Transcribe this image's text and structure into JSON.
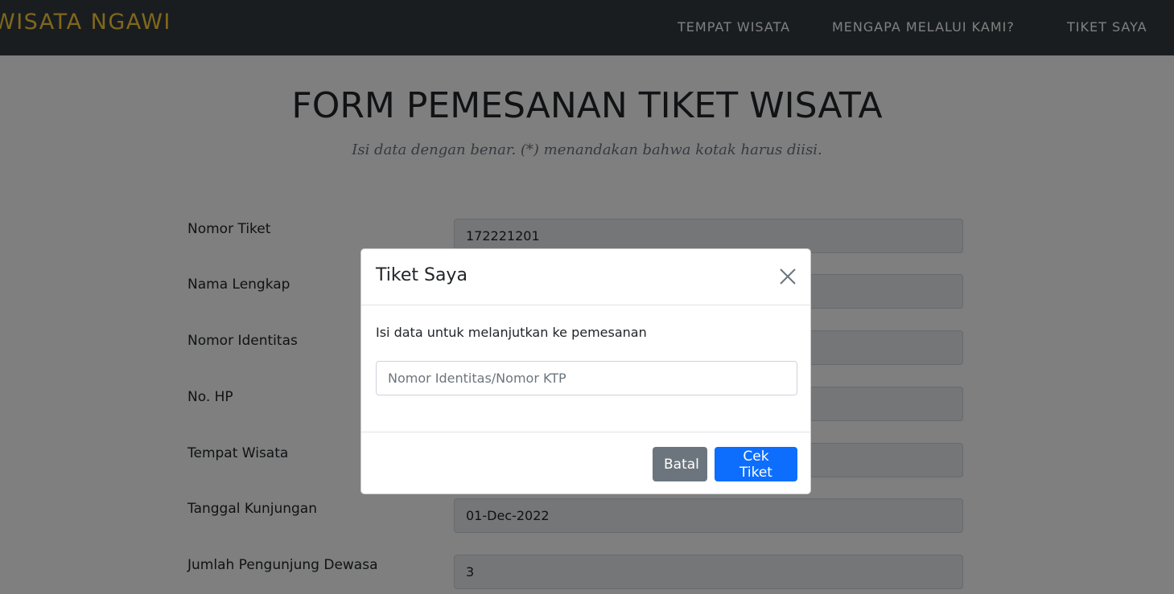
{
  "navbar": {
    "brand": "WISATA NGAWI",
    "links": [
      "TEMPAT WISATA",
      "MENGAPA MELALUI KAMI?",
      "TIKET SAYA"
    ]
  },
  "page": {
    "title": "FORM PEMESANAN TIKET WISATA",
    "subtitle": "Isi data dengan benar. (*) menandakan bahwa kotak harus diisi."
  },
  "form": {
    "fields": [
      {
        "label": "Nomor Tiket",
        "value": "172221201"
      },
      {
        "label": "Nama Lengkap",
        "value": ""
      },
      {
        "label": "Nomor Identitas",
        "value": ""
      },
      {
        "label": "No. HP",
        "value": ""
      },
      {
        "label": "Tempat Wisata",
        "value": ""
      },
      {
        "label": "Tanggal Kunjungan",
        "value": "01-Dec-2022"
      },
      {
        "label": "Jumlah Pengunjung Dewasa",
        "value": "3"
      }
    ]
  },
  "modal": {
    "title": "Tiket Saya",
    "body_text": "Isi data untuk melanjutkan ke pemesanan",
    "input_placeholder": "Nomor Identitas/Nomor KTP",
    "input_value": "",
    "cancel_label": "Batal",
    "submit_label": "Cek Tiket"
  },
  "colors": {
    "navbar_bg": "#343a40",
    "brand": "#fed136",
    "primary": "#0d6efd",
    "secondary": "#6c757d"
  },
  "icons": {
    "close": "close-icon"
  }
}
